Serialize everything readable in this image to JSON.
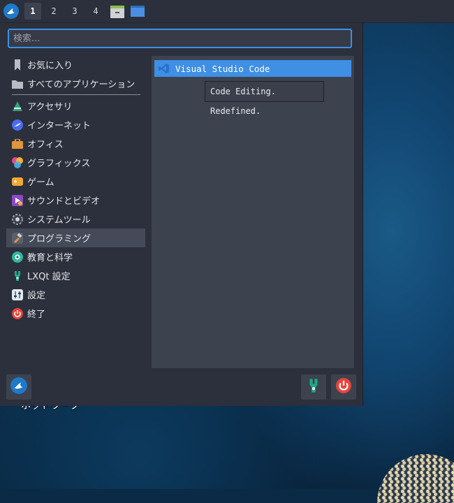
{
  "taskbar": {
    "workspaces": [
      "1",
      "2",
      "3",
      "4"
    ],
    "active_workspace": "1",
    "icons": [
      "lubuntu-logo-icon",
      "file-manager-icon",
      "show-desktop-icon"
    ]
  },
  "menu": {
    "search": {
      "placeholder": "検索...",
      "value": ""
    },
    "categories": [
      {
        "label": "お気に入り",
        "icon": "bookmark-icon"
      },
      {
        "label": "すべてのアプリケーション",
        "icon": "folder-icon"
      },
      {
        "label": "アクセサリ",
        "icon": "accessories-icon"
      },
      {
        "label": "インターネット",
        "icon": "internet-icon"
      },
      {
        "label": "オフィス",
        "icon": "office-icon"
      },
      {
        "label": "グラフィックス",
        "icon": "graphics-icon"
      },
      {
        "label": "ゲーム",
        "icon": "games-icon"
      },
      {
        "label": "サウンドとビデオ",
        "icon": "multimedia-icon"
      },
      {
        "label": "システムツール",
        "icon": "system-tools-icon"
      },
      {
        "label": "プログラミング",
        "icon": "programming-icon",
        "selected": true
      },
      {
        "label": "教育と科学",
        "icon": "education-icon"
      },
      {
        "label": "LXQt 設定",
        "icon": "lxqt-settings-icon"
      },
      {
        "label": "設定",
        "icon": "settings-icon"
      },
      {
        "label": "終了",
        "icon": "leave-icon"
      }
    ],
    "apps": [
      {
        "label": "Visual Studio Code",
        "icon": "vscode-icon",
        "selected": true
      }
    ],
    "tooltip": "Code Editing. Redefined.",
    "bottom_buttons": [
      "lubuntu-logo-icon",
      "lxqt-settings-icon",
      "power-icon"
    ]
  },
  "desktop": {
    "label": "ホットワーク"
  },
  "colors": {
    "accent": "#3f8fe5",
    "panel": "#2c303c",
    "apps_bg": "#3d424f",
    "power": "#e8453c"
  }
}
